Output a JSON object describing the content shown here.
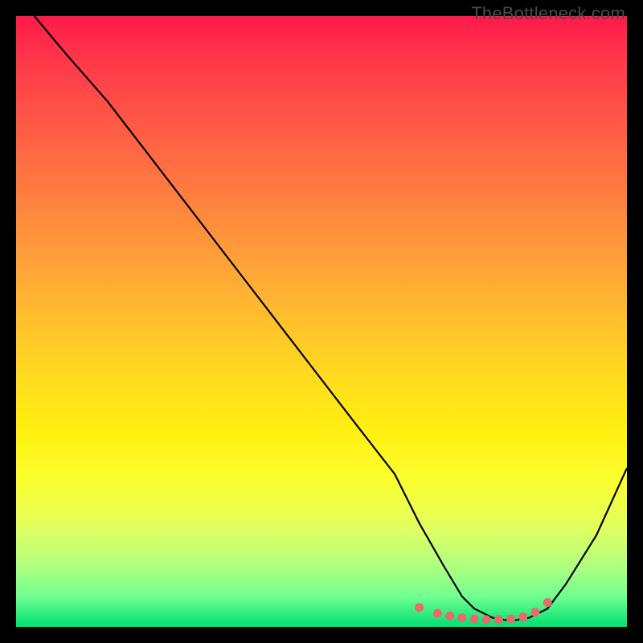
{
  "watermark": "TheBottleneck.com",
  "chart_data": {
    "type": "line",
    "title": "",
    "xlabel": "",
    "ylabel": "",
    "xlim": [
      0,
      100
    ],
    "ylim": [
      0,
      100
    ],
    "series": [
      {
        "name": "curve",
        "x": [
          3,
          8,
          15,
          25,
          35,
          45,
          55,
          62,
          66,
          70,
          73,
          75,
          78,
          81,
          84,
          87,
          90,
          95,
          100
        ],
        "y": [
          100,
          94,
          86,
          73,
          60,
          47,
          34,
          25,
          17,
          10,
          5,
          3,
          1.5,
          1,
          1.5,
          3,
          7,
          15,
          26
        ]
      }
    ],
    "markers": {
      "name": "dots",
      "color": "#e86a6a",
      "x": [
        66,
        69,
        71,
        73,
        75,
        77,
        79,
        81,
        83,
        85,
        87
      ],
      "y": [
        3.2,
        2.2,
        1.8,
        1.5,
        1.3,
        1.2,
        1.2,
        1.3,
        1.6,
        2.4,
        4.0
      ]
    },
    "colors": {
      "curve": "#000000",
      "markers": "#e86a6a",
      "gradient_top": "#ff1a4a",
      "gradient_bottom": "#00e070"
    }
  }
}
